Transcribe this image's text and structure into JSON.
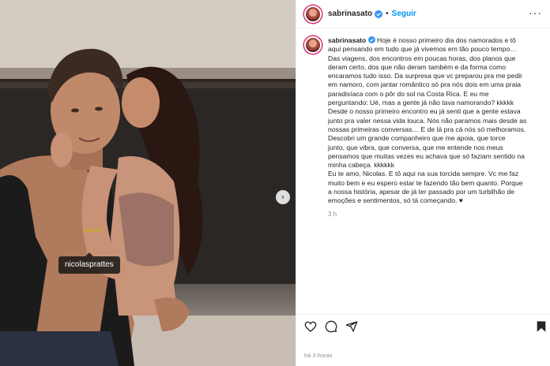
{
  "photo": {
    "tag_username": "nicolasprattes",
    "next_arrow": "›"
  },
  "post": {
    "author": "sabrinasato",
    "follow_label": "Seguir",
    "separator": "•",
    "more_label": "···",
    "caption_lines": [
      "Hoje é nosso primeiro dia dos namorados e tô",
      "aqui pensando em tudo que já vivemos em tão pouco tempo…",
      "Das viagens, dos encontros em poucas horas, dos planos que",
      "deram certo, dos que não deram também e da forma como",
      "encaramos tudo isso. Da surpresa que vc preparou pra me pedir",
      "em namoro, com jantar romântico só pra nós dois em uma praia",
      "paradisíaca com o pôr do sol na Costa Rica. E eu me",
      "perguntando: Ué, mas a gente já não tava namorando? kkkkk",
      "Desde o nosso primeiro encontro eu já senti que a gente estava",
      "junto pra valer nessa vida louca. Nós não paramos mais desde as",
      "nossas primeiras conversas… E de lá pra cá nós só melhoramos.",
      "Descobri um grande companheiro que me apoia, que torce",
      "junto, que vibra, que conversa, que me entende nos meus",
      "pensamos que muitas vezes eu achava que só faziam sentido na",
      "minha cabeça. kkkkkk",
      "Eu te amo, Nicolas. E tô aqui na sua torcida sempre. Vc me faz",
      "muito bem e eu espero estar te fazendo tão bem quanto. Porque",
      "a nossa história, apesar de já ter passado por um turbilhão de",
      "emoções e sentimentos, só tá começando. ♥"
    ],
    "comment_time": "3 h",
    "footer_time": "há 3 horas"
  },
  "colors": {
    "follow_blue": "#0095f6",
    "verified_blue": "#3897f0",
    "text": "#262626",
    "muted": "#8e8e8e"
  },
  "icons": [
    "verified-badge-icon",
    "heart-icon",
    "comment-icon",
    "share-icon",
    "bookmark-icon",
    "more-icon"
  ]
}
